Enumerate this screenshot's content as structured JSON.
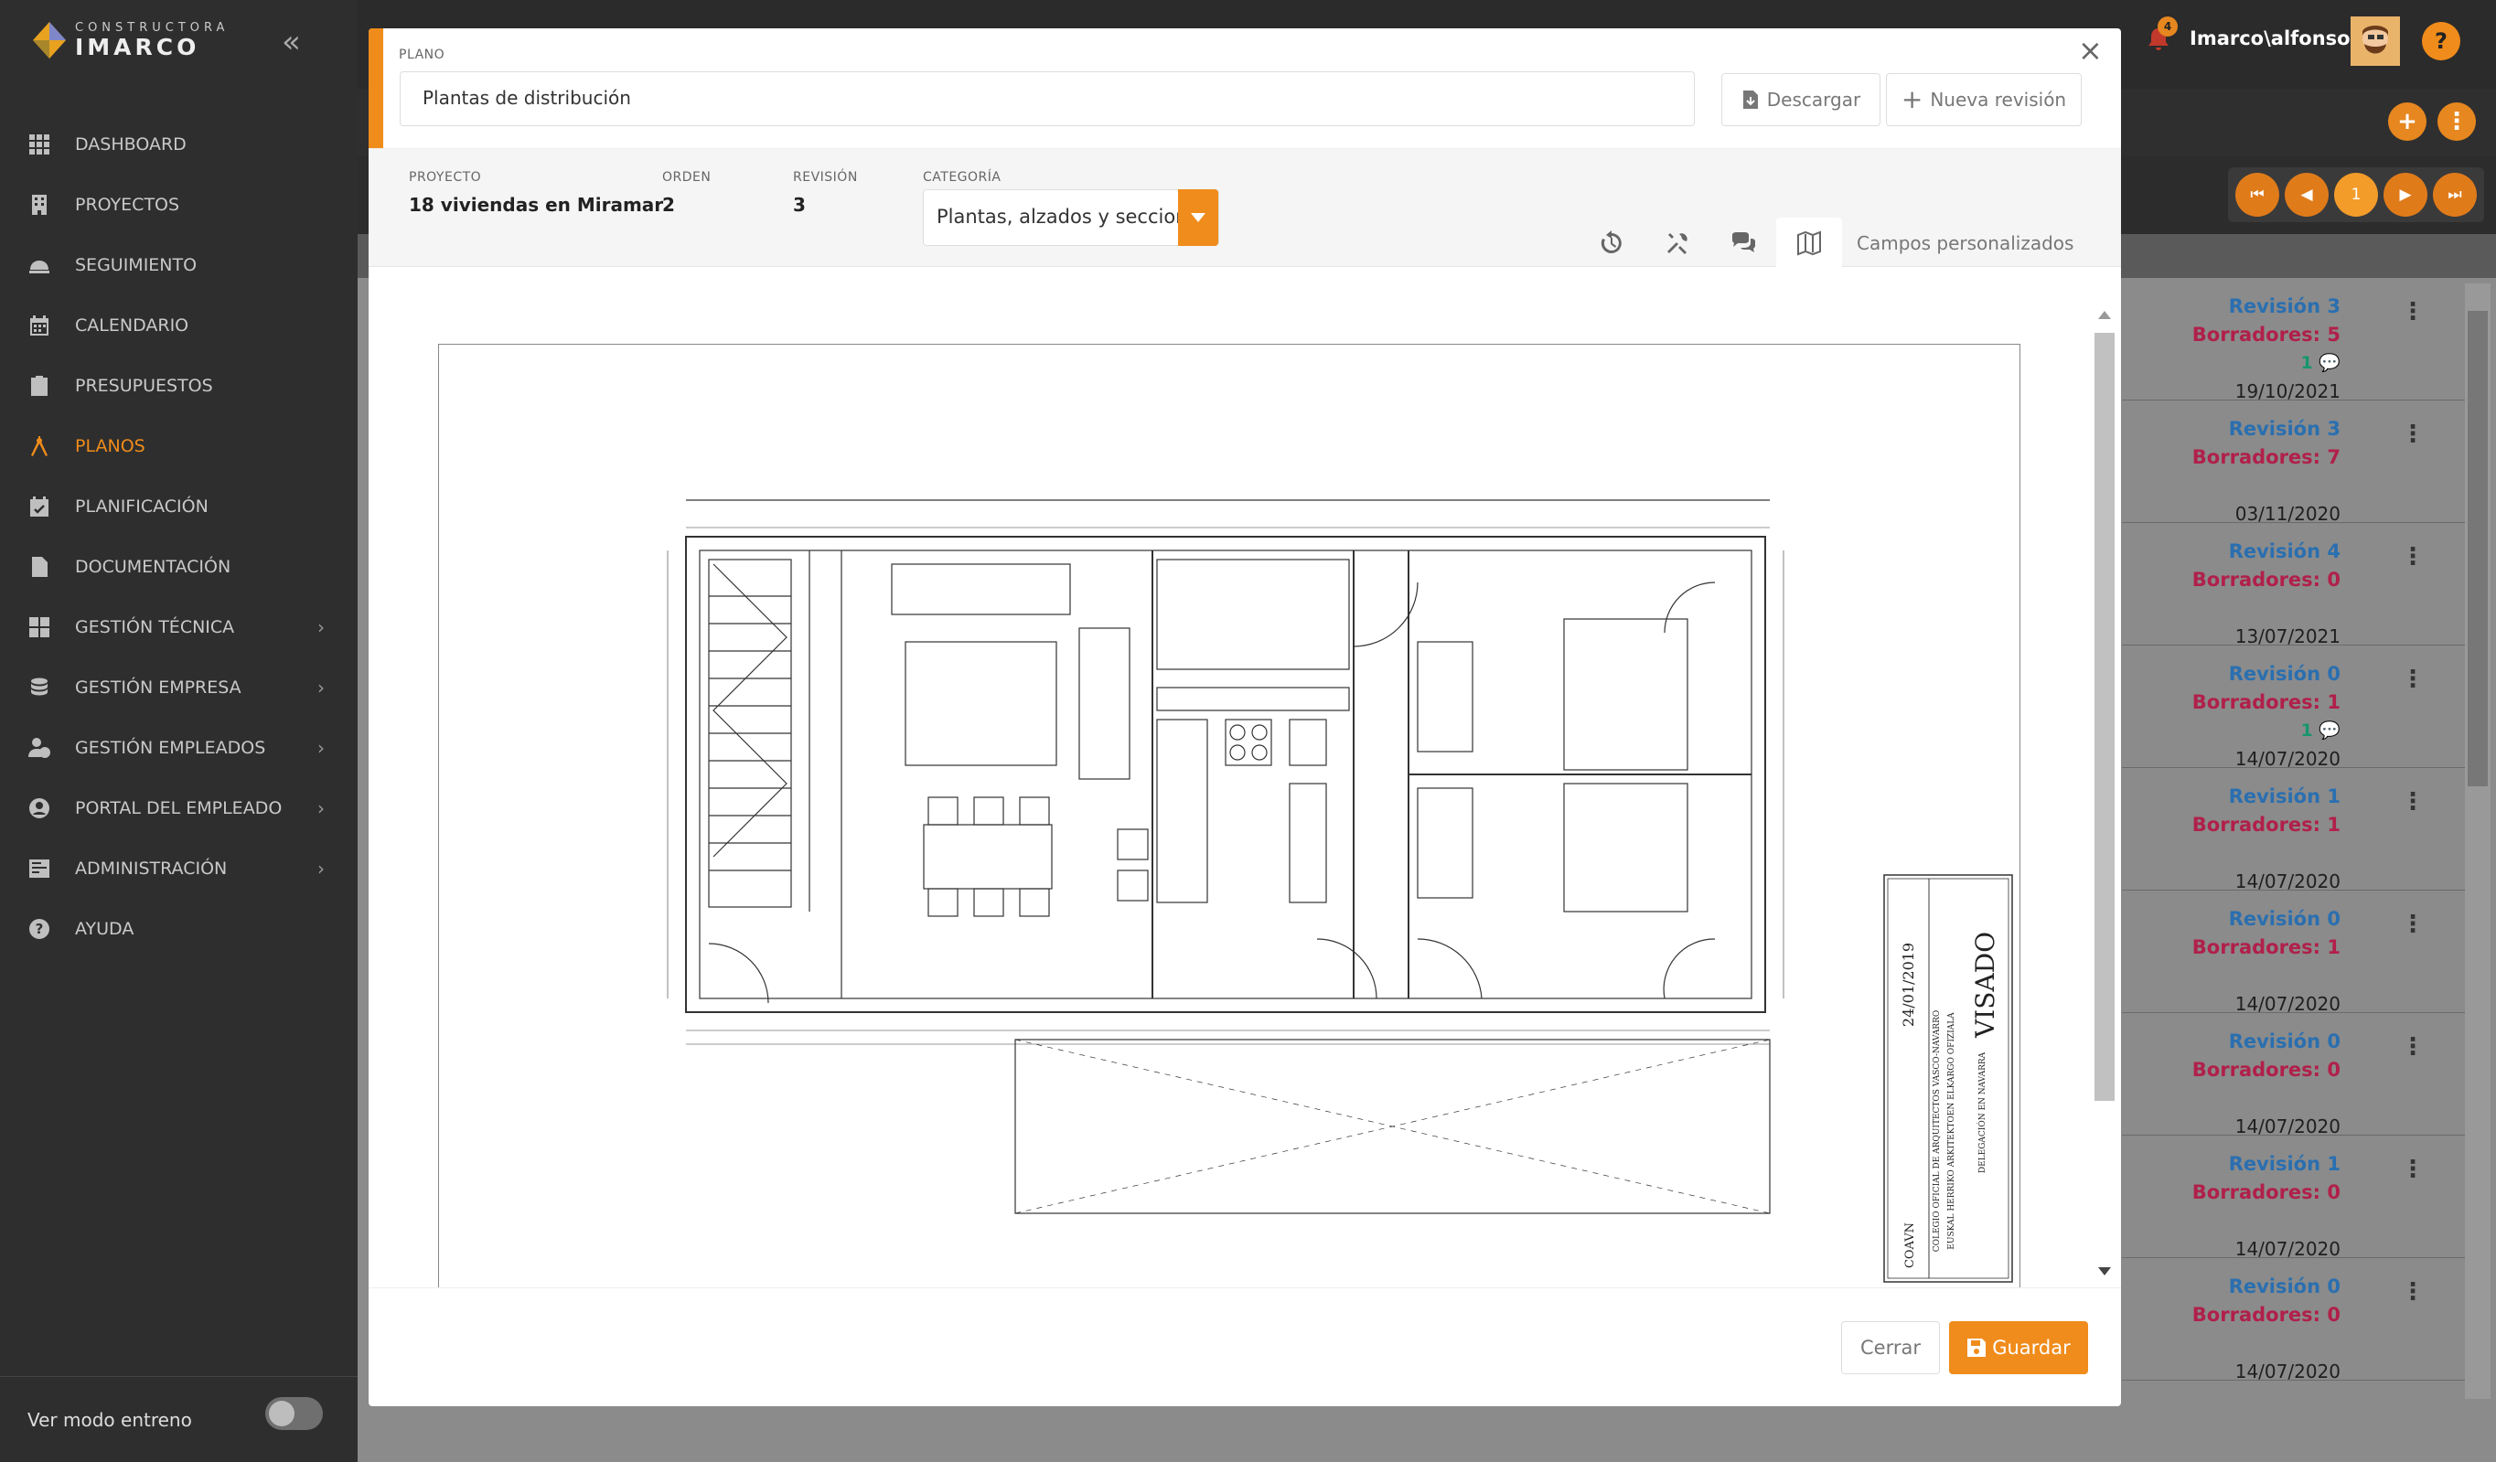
{
  "brand": {
    "line1": "CONSTRUCTORA",
    "line2": "IMARCO"
  },
  "sidebar": {
    "items": [
      {
        "label": "DASHBOARD",
        "icon": "grid-icon"
      },
      {
        "label": "PROYECTOS",
        "icon": "building-icon"
      },
      {
        "label": "SEGUIMIENTO",
        "icon": "helmet-icon"
      },
      {
        "label": "CALENDARIO",
        "icon": "calendar-icon"
      },
      {
        "label": "PRESUPUESTOS",
        "icon": "clipboard-icon"
      },
      {
        "label": "PLANOS",
        "icon": "compass-icon",
        "active": true
      },
      {
        "label": "PLANIFICACIÓN",
        "icon": "calendar-check-icon"
      },
      {
        "label": "DOCUMENTACIÓN",
        "icon": "file-icon"
      },
      {
        "label": "GESTIÓN TÉCNICA",
        "icon": "grid-icon",
        "chevron": true
      },
      {
        "label": "GESTIÓN EMPRESA",
        "icon": "coins-icon",
        "chevron": true
      },
      {
        "label": "GESTIÓN EMPLEADOS",
        "icon": "user-clock-icon",
        "chevron": true
      },
      {
        "label": "PORTAL DEL EMPLEADO",
        "icon": "user-circle-icon",
        "chevron": true
      },
      {
        "label": "ADMINISTRACIÓN",
        "icon": "tools-icon",
        "chevron": true
      },
      {
        "label": "AYUDA",
        "icon": "question-icon"
      }
    ],
    "training_label": "Ver modo entreno"
  },
  "topbar": {
    "user": "Imarco\\alfonso",
    "notifications": "4",
    "help": "?"
  },
  "pager": {
    "current": "1"
  },
  "bg_rows": [
    {
      "revision": "Revisión 3",
      "borradores": "Borradores: 5",
      "comments": "1",
      "date": "19/10/2021"
    },
    {
      "revision": "Revisión 3",
      "borradores": "Borradores: 7",
      "comments": "",
      "date": "03/11/2020"
    },
    {
      "revision": "Revisión 4",
      "borradores": "Borradores: 0",
      "comments": "",
      "date": "13/07/2021"
    },
    {
      "revision": "Revisión 0",
      "borradores": "Borradores: 1",
      "comments": "1",
      "date": "14/07/2020"
    },
    {
      "revision": "Revisión 1",
      "borradores": "Borradores: 1",
      "comments": "",
      "date": "14/07/2020"
    },
    {
      "revision": "Revisión 0",
      "borradores": "Borradores: 1",
      "comments": "",
      "date": "14/07/2020"
    },
    {
      "revision": "Revisión 0",
      "borradores": "Borradores: 0",
      "comments": "",
      "date": "14/07/2020"
    },
    {
      "revision": "Revisión 1",
      "borradores": "Borradores: 0",
      "comments": "",
      "date": "14/07/2020"
    },
    {
      "revision": "Revisión 0",
      "borradores": "Borradores: 0",
      "comments": "",
      "date": "14/07/2020"
    }
  ],
  "modal": {
    "plano_label": "PLANO",
    "plano_name": "Plantas de distribución",
    "download_label": "Descargar",
    "new_revision_label": "Nueva revisión",
    "proyecto_label": "PROYECTO",
    "proyecto_value": "18 viviendas en Miramar",
    "orden_label": "ORDEN",
    "orden_value": "2",
    "revision_label": "REVISIÓN",
    "revision_value": "3",
    "categoria_label": "CATEGORÍA",
    "categoria_value": "Plantas, alzados y secciones",
    "custom_fields_label": "Campos personalizados",
    "cancel_label": "Cerrar",
    "save_label": "Guardar"
  },
  "drawing": {
    "stamp_title": "VISADO",
    "stamp_date": "24/01/2019",
    "stamp_org": "COLEGIO OFICIAL DE ARQUITECTOS VASCO-NAVARRO",
    "stamp_org2": "EUSKAL HERRIKO ARKITEKTOEN ELKARGO OFIZIALA",
    "stamp_del": "DELEGACIÓN EN NAVARRA",
    "stamp_logo": "COAVN"
  },
  "colors": {
    "accent": "#f08c1b",
    "sidebar": "#2e2e2e",
    "revision": "#2a6fb0",
    "borradores": "#b0204a",
    "comments": "#16966d"
  }
}
